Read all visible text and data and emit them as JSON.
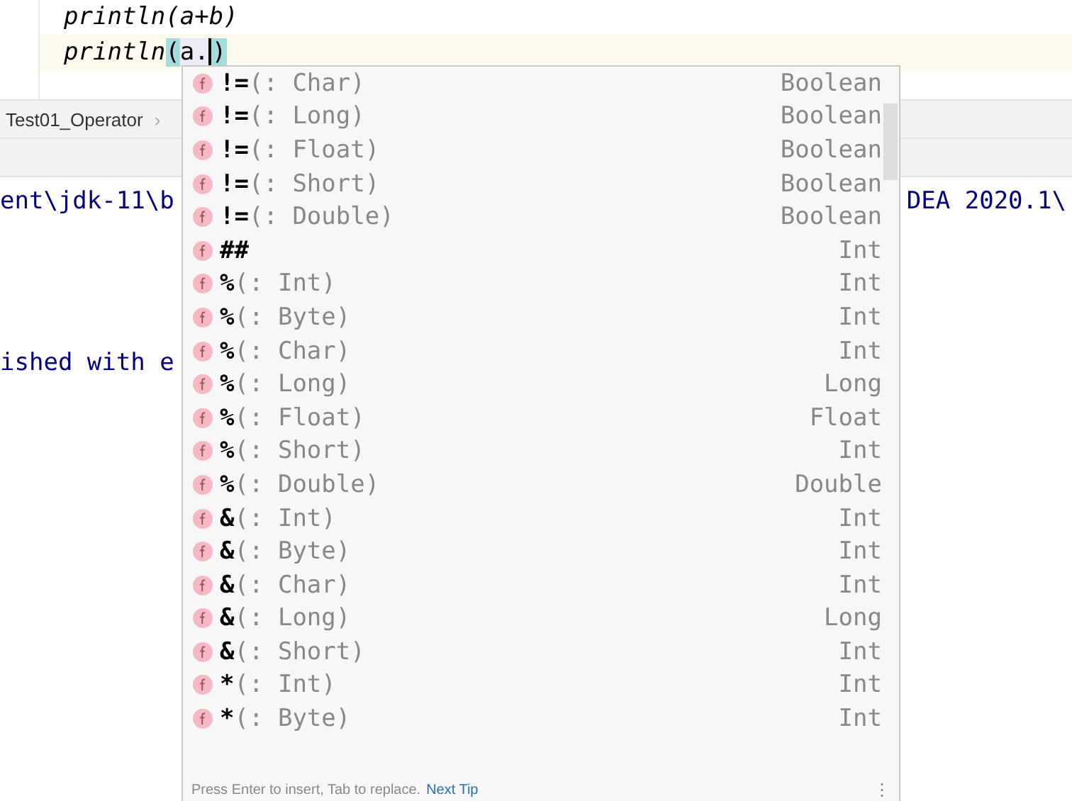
{
  "editor": {
    "lines": [
      {
        "text": "println(a+b)",
        "current": false
      },
      {
        "text": "println",
        "open": "(",
        "arg": "a.",
        "close": ")",
        "current": true
      }
    ]
  },
  "breadcrumb": {
    "items": [
      "Test01_Operator"
    ],
    "separator": "›"
  },
  "console": {
    "lines": [
      {
        "left": "ent\\jdk-11\\b",
        "right": "DEA 2020.1\\"
      },
      {
        "left": "ished with e"
      }
    ]
  },
  "completion": {
    "items": [
      {
        "name": "**!=**(: Char)",
        "type": "Boolean"
      },
      {
        "name": "**!=**(: Long)",
        "type": "Boolean"
      },
      {
        "name": "**!=**(: Float)",
        "type": "Boolean"
      },
      {
        "name": "**!=**(: Short)",
        "type": "Boolean"
      },
      {
        "name": "**!=**(: Double)",
        "type": "Boolean"
      },
      {
        "name": "**##**",
        "type": "Int"
      },
      {
        "name": "**%**(: Int)",
        "type": "Int"
      },
      {
        "name": "**%**(: Byte)",
        "type": "Int"
      },
      {
        "name": "**%**(: Char)",
        "type": "Int"
      },
      {
        "name": "**%**(: Long)",
        "type": "Long"
      },
      {
        "name": "**%**(: Float)",
        "type": "Float"
      },
      {
        "name": "**%**(: Short)",
        "type": "Int"
      },
      {
        "name": "**%**(: Double)",
        "type": "Double"
      },
      {
        "name": "**&**(: Int)",
        "type": "Int"
      },
      {
        "name": "**&**(: Byte)",
        "type": "Int"
      },
      {
        "name": "**&**(: Char)",
        "type": "Int"
      },
      {
        "name": "**&**(: Long)",
        "type": "Long"
      },
      {
        "name": "**&**(: Short)",
        "type": "Int"
      },
      {
        "name": "*****(: Int)",
        "type": "Int"
      },
      {
        "name": "*****(: Byte)",
        "type": "Int"
      }
    ],
    "hint": "Press Enter to insert, Tab to replace.",
    "link": "Next Tip",
    "menu": "⋮"
  }
}
